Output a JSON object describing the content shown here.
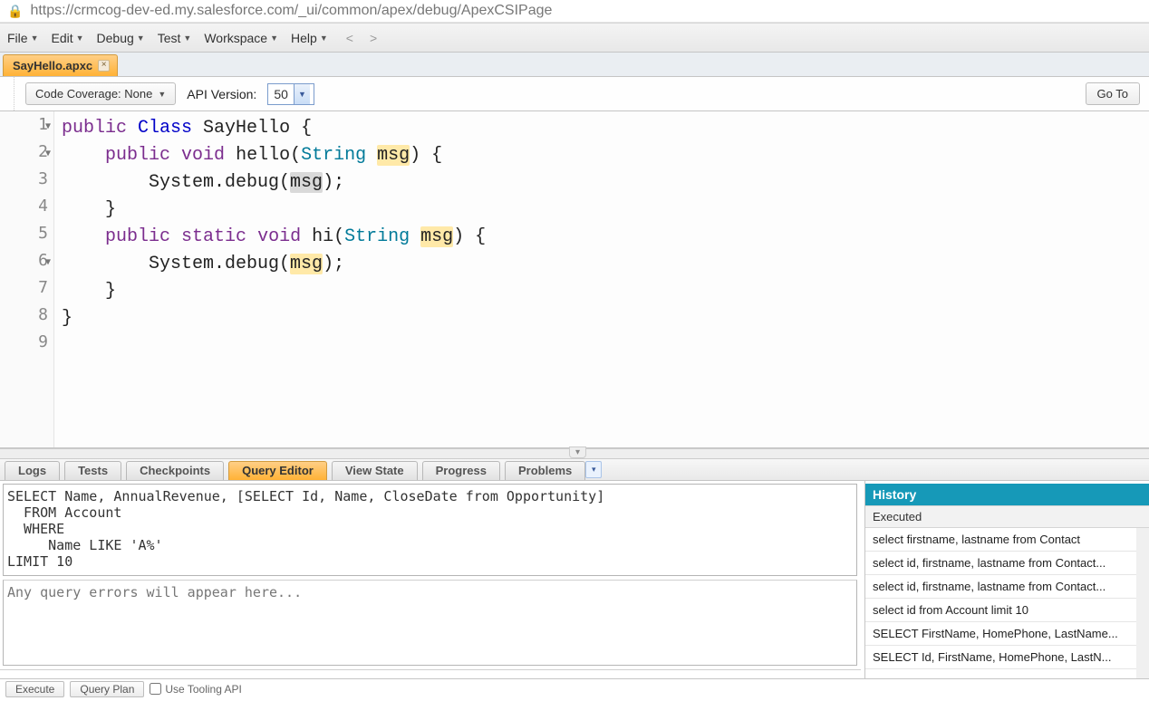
{
  "url": "https://crmcog-dev-ed.my.salesforce.com/_ui/common/apex/debug/ApexCSIPage",
  "menus": [
    "File",
    "Edit",
    "Debug",
    "Test",
    "Workspace",
    "Help"
  ],
  "nav_prev": "<",
  "nav_next": ">",
  "file_tab": "SayHello.apxc",
  "toolbar": {
    "coverage": "Code Coverage: None",
    "api_label": "API Version:",
    "api_value": "50",
    "goto": "Go To"
  },
  "code": {
    "lines": [
      {
        "n": "1",
        "fold": true,
        "segs": [
          [
            "kw1",
            "public"
          ],
          [
            "",
            " "
          ],
          [
            "kw2",
            "Class"
          ],
          [
            "",
            " SayHello {"
          ]
        ]
      },
      {
        "n": "2",
        "fold": true,
        "segs": [
          [
            "",
            "    "
          ],
          [
            "kw1",
            "public"
          ],
          [
            "",
            " "
          ],
          [
            "kw1",
            "void"
          ],
          [
            "",
            " hello("
          ],
          [
            "typ",
            "String"
          ],
          [
            "",
            " "
          ],
          [
            "hl1",
            "msg"
          ],
          [
            "",
            ") {"
          ]
        ]
      },
      {
        "n": "3",
        "segs": [
          [
            "",
            "        System.debug("
          ],
          [
            "hl2",
            "msg"
          ],
          [
            "",
            ");"
          ]
        ]
      },
      {
        "n": "4",
        "segs": [
          [
            "",
            "    }"
          ]
        ]
      },
      {
        "n": "5",
        "segs": [
          [
            "",
            ""
          ]
        ]
      },
      {
        "n": "6",
        "fold": true,
        "segs": [
          [
            "",
            "    "
          ],
          [
            "kw1",
            "public"
          ],
          [
            "",
            " "
          ],
          [
            "kw1",
            "static"
          ],
          [
            "",
            " "
          ],
          [
            "kw1",
            "void"
          ],
          [
            "",
            " hi("
          ],
          [
            "typ",
            "String"
          ],
          [
            "",
            " "
          ],
          [
            "hl1",
            "msg"
          ],
          [
            "",
            ") {"
          ]
        ]
      },
      {
        "n": "7",
        "segs": [
          [
            "",
            "        System.debug("
          ],
          [
            "hl1",
            "msg"
          ],
          [
            "",
            ");"
          ]
        ]
      },
      {
        "n": "8",
        "segs": [
          [
            "",
            "    }"
          ]
        ]
      },
      {
        "n": "9",
        "segs": [
          [
            "",
            "}"
          ]
        ]
      }
    ]
  },
  "bottom_tabs": [
    "Logs",
    "Tests",
    "Checkpoints",
    "Query Editor",
    "View State",
    "Progress",
    "Problems"
  ],
  "bottom_active": 3,
  "query": "SELECT Name, AnnualRevenue, [SELECT Id, Name, CloseDate from Opportunity]\n  FROM Account\n  WHERE\n     Name LIKE 'A%'\nLIMIT 10",
  "query_err_placeholder": "Any query errors will appear here...",
  "history": {
    "title": "History",
    "col": "Executed",
    "items": [
      "select firstname, lastname from Contact",
      "select id, firstname, lastname from Contact...",
      "select id, firstname, lastname from Contact...",
      "select id from Account limit 10",
      "SELECT FirstName, HomePhone, LastName...",
      "SELECT Id, FirstName, HomePhone, LastN..."
    ]
  },
  "footer": {
    "execute": "Execute",
    "plan": "Query Plan",
    "tooling": "Use Tooling API"
  }
}
